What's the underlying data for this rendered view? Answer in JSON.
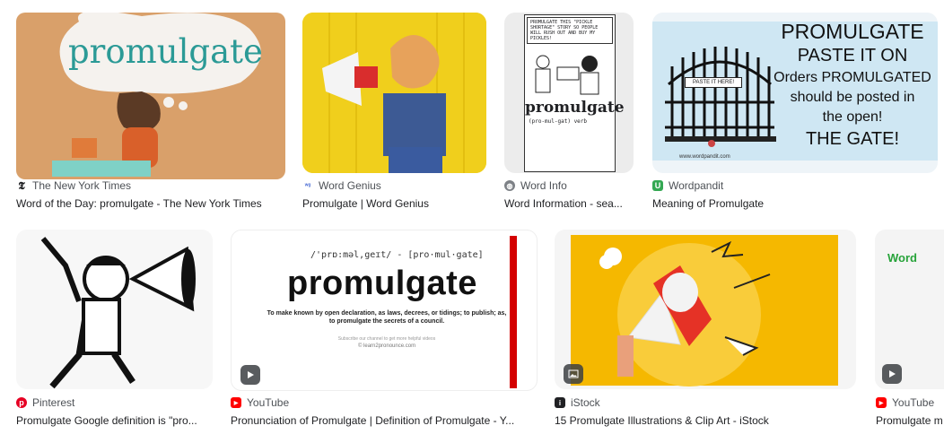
{
  "results": [
    {
      "source": "The New York Times",
      "title": "Word of the Day: promulgate - The New York Times",
      "thumb_text": "promulgate"
    },
    {
      "source": "Word Genius",
      "title": "Promulgate | Word Genius"
    },
    {
      "source": "Word Info",
      "title": "Word Information - sea...",
      "thumb_word": "promulgate",
      "thumb_pron": "(pro-mul-gat) verb",
      "thumb_caption": "PROMULGATE THIS \"PICKLE SHORTAGE\" STORY SO PEOPLE WILL RUSH OUT AND BUY MY PICKLES!"
    },
    {
      "source": "Wordpandit",
      "title": "Meaning of Promulgate",
      "thumb_lines": [
        "PROMULGATE",
        "PASTE IT ON",
        "Orders PROMULGATED",
        "should be posted in",
        "the open!",
        "THE GATE!"
      ],
      "sign": "PASTE IT HERE!",
      "site": "www.wordpandit.com"
    },
    {
      "source": "Pinterest",
      "title": "Promulgate Google definition is \"pro..."
    },
    {
      "source": "YouTube",
      "title": "Pronunciation of Promulgate | Definition of Promulgate - Y...",
      "thumb_pron": "/'prɒ:məl,geɪt/ - [pro·mul·gate]",
      "thumb_word": "promulgate",
      "thumb_def": "To make known by open declaration, as laws, decrees, or tidings; to publish; as, to promulgate the secrets of a council.",
      "thumb_sub": "Subscribe our channel to get more helpful videos",
      "thumb_copy": "© learn2pronounce.com"
    },
    {
      "source": "iStock",
      "title": "15 Promulgate Illustrations & Clip Art - iStock"
    },
    {
      "source": "YouTube",
      "title": "Promulgate m",
      "thumb_text": "Word"
    }
  ],
  "colors": {
    "nyt": "#202124",
    "wordgenius": "#4a6cd4",
    "wordinfo": "#5f6368",
    "wordpandit": "#34a853",
    "pinterest": "#e60023",
    "youtube": "#ff0000",
    "istock": "#202124"
  }
}
